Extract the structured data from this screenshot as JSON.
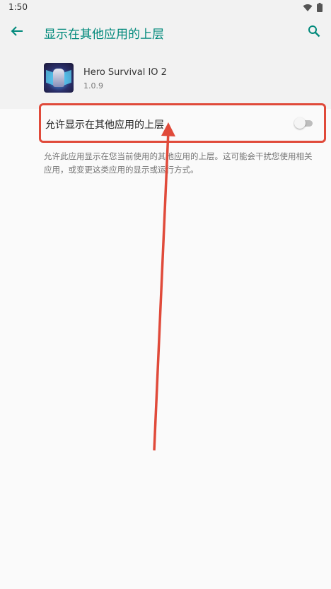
{
  "status_bar": {
    "time": "1:50",
    "icons": [
      "wifi-icon",
      "battery-icon"
    ]
  },
  "app_bar": {
    "back_icon": "arrow-back-icon",
    "title": "显示在其他应用的上层",
    "search_icon": "search-icon",
    "accent_color": "#00897b"
  },
  "app_info": {
    "icon": "app-icon",
    "name": "Hero Survival IO 2",
    "version": "1.0.9"
  },
  "setting": {
    "label": "允许显示在其他应用的上层",
    "enabled": false,
    "description": "允许此应用显示在您当前使用的其他应用的上层。这可能会干扰您使用相关应用，或变更这类应用的显示或运行方式。"
  },
  "annotation": {
    "highlight_color": "#e04a3a"
  }
}
